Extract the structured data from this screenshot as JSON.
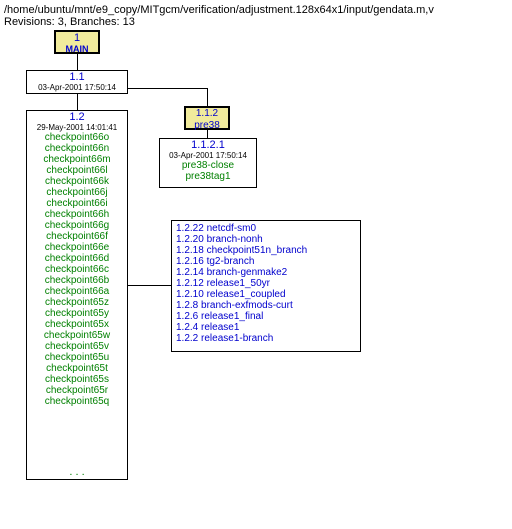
{
  "header": {
    "path": "/home/ubuntu/mnt/e9_copy/MITgcm/verification/adjustment.128x64x1/input/gendata.m,v",
    "stats": "Revisions: 3, Branches: 13"
  },
  "main": {
    "num": "1",
    "label": "MAIN"
  },
  "rev11": {
    "num": "1.1",
    "date": "03-Apr-2001 17:50:14"
  },
  "rev12": {
    "num": "1.2",
    "date": "29-May-2001 14:01:41",
    "tags": [
      "checkpoint66o",
      "checkpoint66n",
      "checkpoint66m",
      "checkpoint66l",
      "checkpoint66k",
      "checkpoint66j",
      "checkpoint66i",
      "checkpoint66h",
      "checkpoint66g",
      "checkpoint66f",
      "checkpoint66e",
      "checkpoint66d",
      "checkpoint66c",
      "checkpoint66b",
      "checkpoint66a",
      "checkpoint65z",
      "checkpoint65y",
      "checkpoint65x",
      "checkpoint65w",
      "checkpoint65v",
      "checkpoint65u",
      "checkpoint65t",
      "checkpoint65s",
      "checkpoint65r",
      "checkpoint65q"
    ],
    "ellipsis": ". . ."
  },
  "pre38": {
    "num": "1.1.2",
    "label": "pre38"
  },
  "rev1121": {
    "num": "1.1.2.1",
    "date": "03-Apr-2001 17:50:14",
    "tags": [
      "pre38-close",
      "pre38tag1"
    ]
  },
  "sidebox": {
    "rows": [
      {
        "v": "1.2.22",
        "t": "netcdf-sm0"
      },
      {
        "v": "1.2.20",
        "t": "branch-nonh"
      },
      {
        "v": "1.2.18",
        "t": "checkpoint51n_branch"
      },
      {
        "v": "1.2.16",
        "t": "tg2-branch"
      },
      {
        "v": "1.2.14",
        "t": "branch-genmake2"
      },
      {
        "v": "1.2.12",
        "t": "release1_50yr"
      },
      {
        "v": "1.2.10",
        "t": "release1_coupled"
      },
      {
        "v": "1.2.8",
        "t": "branch-exfmods-curt"
      },
      {
        "v": "1.2.6",
        "t": "release1_final"
      },
      {
        "v": "1.2.4",
        "t": "release1"
      },
      {
        "v": "1.2.2",
        "t": "release1-branch"
      }
    ]
  }
}
